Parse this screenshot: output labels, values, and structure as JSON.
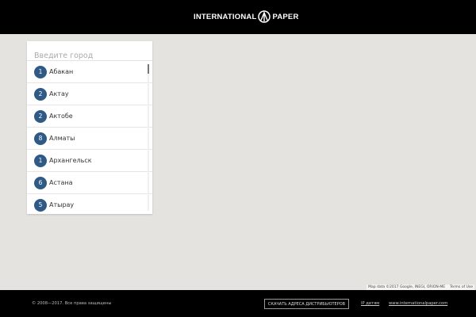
{
  "header": {
    "logo_left": "INTERNATIONAL",
    "logo_right": "PAPER"
  },
  "search": {
    "placeholder": "Введите город"
  },
  "cities": [
    {
      "count": "1",
      "name": "Абакан"
    },
    {
      "count": "2",
      "name": "Актау"
    },
    {
      "count": "2",
      "name": "Актобе"
    },
    {
      "count": "8",
      "name": "Алматы"
    },
    {
      "count": "1",
      "name": "Архангельск"
    },
    {
      "count": "6",
      "name": "Астана"
    },
    {
      "count": "5",
      "name": "Атырау"
    }
  ],
  "map": {
    "data_text": "Map data ©2017 Google, INEGI, ORION-ME",
    "terms": "Terms of Use"
  },
  "footer": {
    "copyright": "© 2008—2017. Все права защищены",
    "download_button": "СКАЧАТЬ АДРЕСА ДИСТРИБЬЮТЕРОВ",
    "link_ip": "IP детям",
    "link_site": "www.internationalpaper.com"
  },
  "colors": {
    "badge": "#2f5a86",
    "header_bg": "#000000",
    "map_bg": "#e5e3df"
  }
}
